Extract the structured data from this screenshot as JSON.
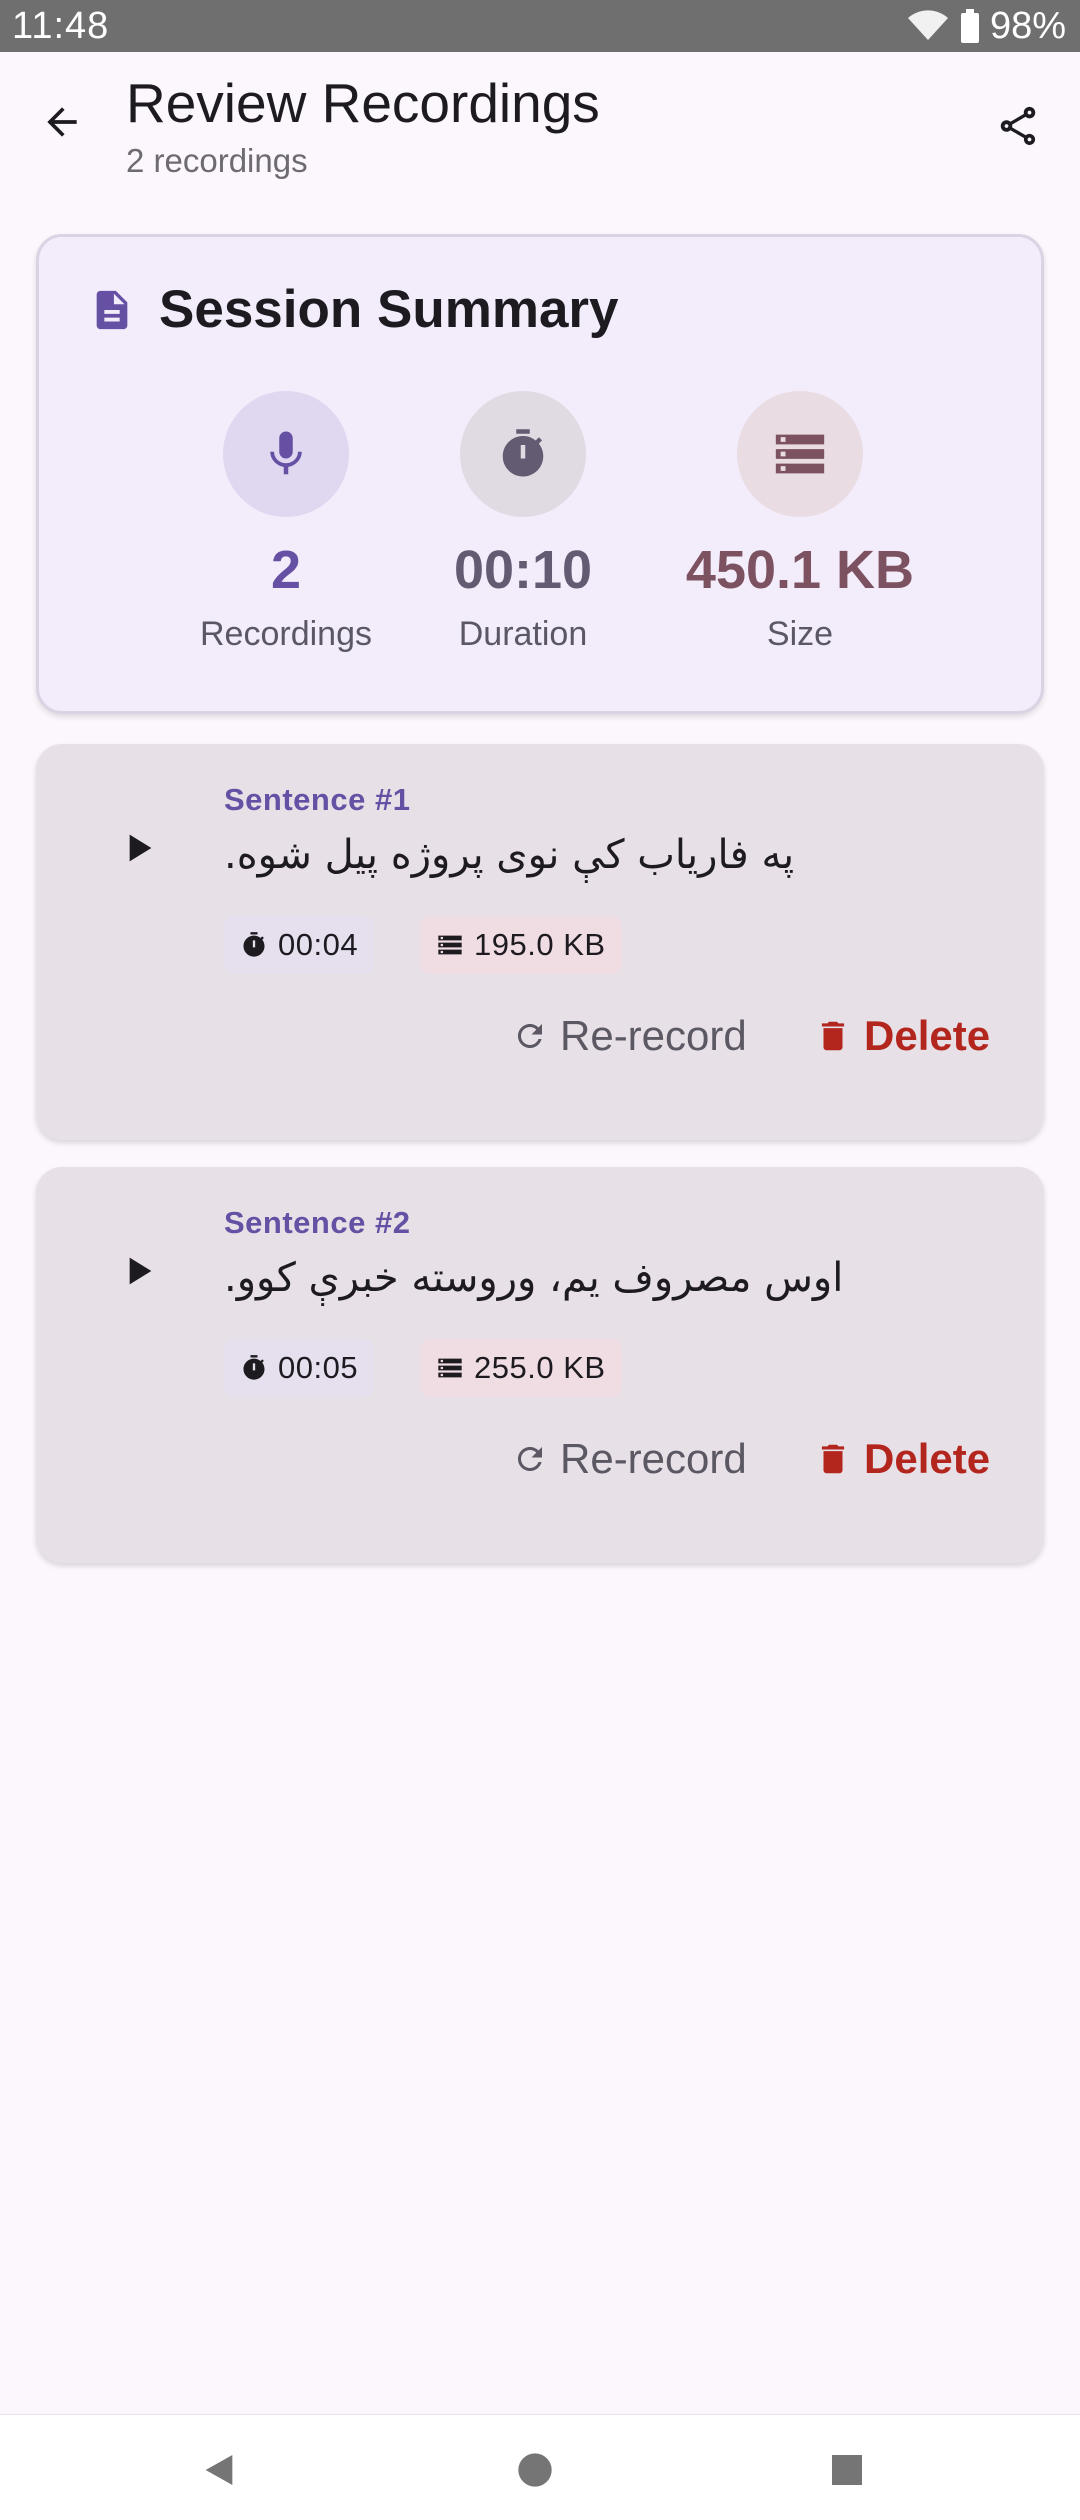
{
  "status_bar": {
    "time": "11:48",
    "battery": "98%"
  },
  "app_bar": {
    "title": "Review Recordings",
    "subtitle": "2 recordings"
  },
  "summary": {
    "title": "Session Summary",
    "stats": [
      {
        "value": "2",
        "label": "Recordings",
        "icon": "mic-icon",
        "color": "#6650a4"
      },
      {
        "value": "00:10",
        "label": "Duration",
        "icon": "timer-icon",
        "color": "#625b71"
      },
      {
        "value": "450.1 KB",
        "label": "Size",
        "icon": "storage-icon",
        "color": "#7d5260"
      }
    ]
  },
  "recordings": [
    {
      "number": "Sentence #1",
      "text": "په فاریاب کې نوی پروژه پیل شوه.",
      "duration": "00:04",
      "size": "195.0 KB",
      "rerecord_label": "Re-record",
      "delete_label": "Delete"
    },
    {
      "number": "Sentence #2",
      "text": "اوس مصروف یم، وروسته خبرې کوو.",
      "duration": "00:05",
      "size": "255.0 KB",
      "rerecord_label": "Re-record",
      "delete_label": "Delete"
    }
  ],
  "colors": {
    "primary": "#6650a4",
    "error": "#b3261e",
    "tertiary": "#7d5260"
  }
}
